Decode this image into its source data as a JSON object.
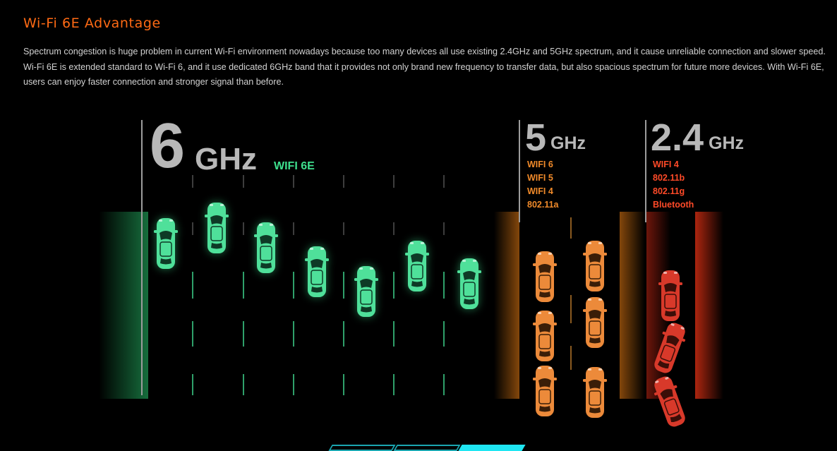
{
  "header": {
    "title": "Wi-Fi 6E Advantage",
    "paragraph_line_1": "Spectrum congestion is huge problem in current Wi-Fi environment nowadays because too many devices all use existing 2.4GHz and 5GHz spectrum, and it cause unreliable connection and slower speed.",
    "paragraph_line_2": "Wi-Fi 6E is extended standard to Wi-Fi 6, and it use dedicated 6GHz band that it provides not only brand new frequency to transfer data, but also spacious spectrum for future more devices. With Wi-Fi 6E,",
    "paragraph_line_3": "users can enjoy faster connection and stronger signal than before."
  },
  "bands": {
    "six": {
      "number": "6",
      "unit": "GHz",
      "tag": "WIFI 6E",
      "color": "#3ee08e",
      "car_count": 7
    },
    "five": {
      "number": "5",
      "unit": "GHz",
      "standards": [
        "WIFI 6",
        "WIFI 5",
        "WIFI 4",
        "802.11a"
      ],
      "color": "#f08a2a",
      "car_count": 6
    },
    "two_four": {
      "number": "2.4",
      "unit": "GHz",
      "standards": [
        "WIFI 4",
        "802.11b",
        "802.11g",
        "Bluetooth"
      ],
      "color": "#ff4a28",
      "car_count": 3
    }
  },
  "carousel": {
    "slides": 3,
    "active_index": 2,
    "active_color": "#1fe6f2",
    "inactive_color": "#1aa6b0"
  }
}
